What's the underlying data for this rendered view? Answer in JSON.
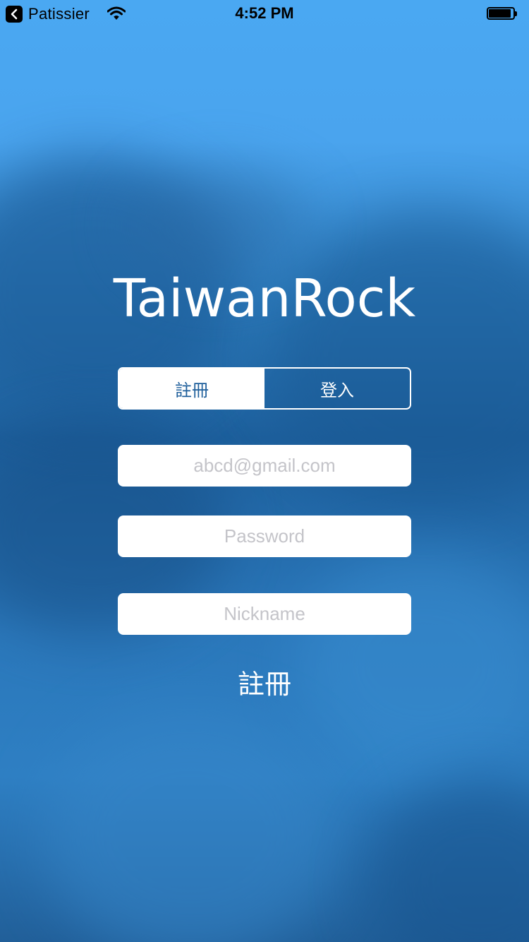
{
  "status_bar": {
    "back_app": "Patissier",
    "time": "4:52 PM",
    "battery_level": 0.9
  },
  "app": {
    "title": "TaiwanRock"
  },
  "segmented": {
    "register_label": "註冊",
    "login_label": "登入",
    "selected": "register"
  },
  "form": {
    "email_placeholder": "abcd@gmail.com",
    "password_placeholder": "Password",
    "nickname_placeholder": "Nickname",
    "email_value": "",
    "password_value": "",
    "nickname_value": ""
  },
  "submit": {
    "label": "註冊"
  },
  "colors": {
    "sky_top": "#4aa8f2",
    "segment_active_text": "#1f5f9b",
    "white": "#ffffff"
  }
}
